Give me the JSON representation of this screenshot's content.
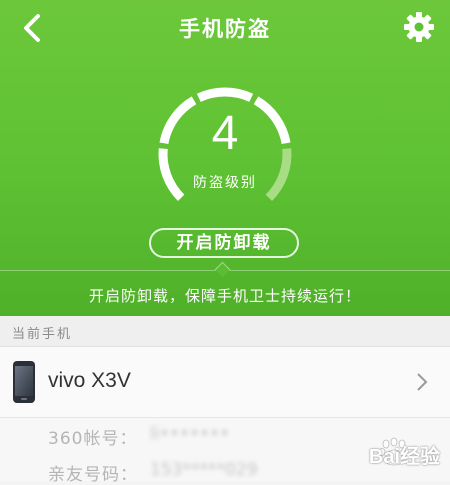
{
  "header": {
    "title": "手机防盗"
  },
  "protection": {
    "level": "4",
    "level_label": "防盗级别",
    "level_value": 4,
    "level_max": 5
  },
  "uninstall_button": {
    "label": "开启防卸载"
  },
  "tagline": "开启防卸载，保障手机卫士持续运行！",
  "current_phone": {
    "section_title": "当前手机",
    "device_name": "vivo X3V",
    "account_label": "360帐号：",
    "account_value": "li•••••••",
    "contact_label": "亲友号码：",
    "contact_value": "153*****029"
  },
  "watermark": {
    "text": "Bai经验"
  },
  "colors": {
    "primary": "#5ec133",
    "gauge_inactive": "#a8dd86"
  },
  "icons": {
    "back": "back-arrow-icon",
    "settings": "gear-icon",
    "device": "phone-icon",
    "chevron": "chevron-right-icon"
  }
}
